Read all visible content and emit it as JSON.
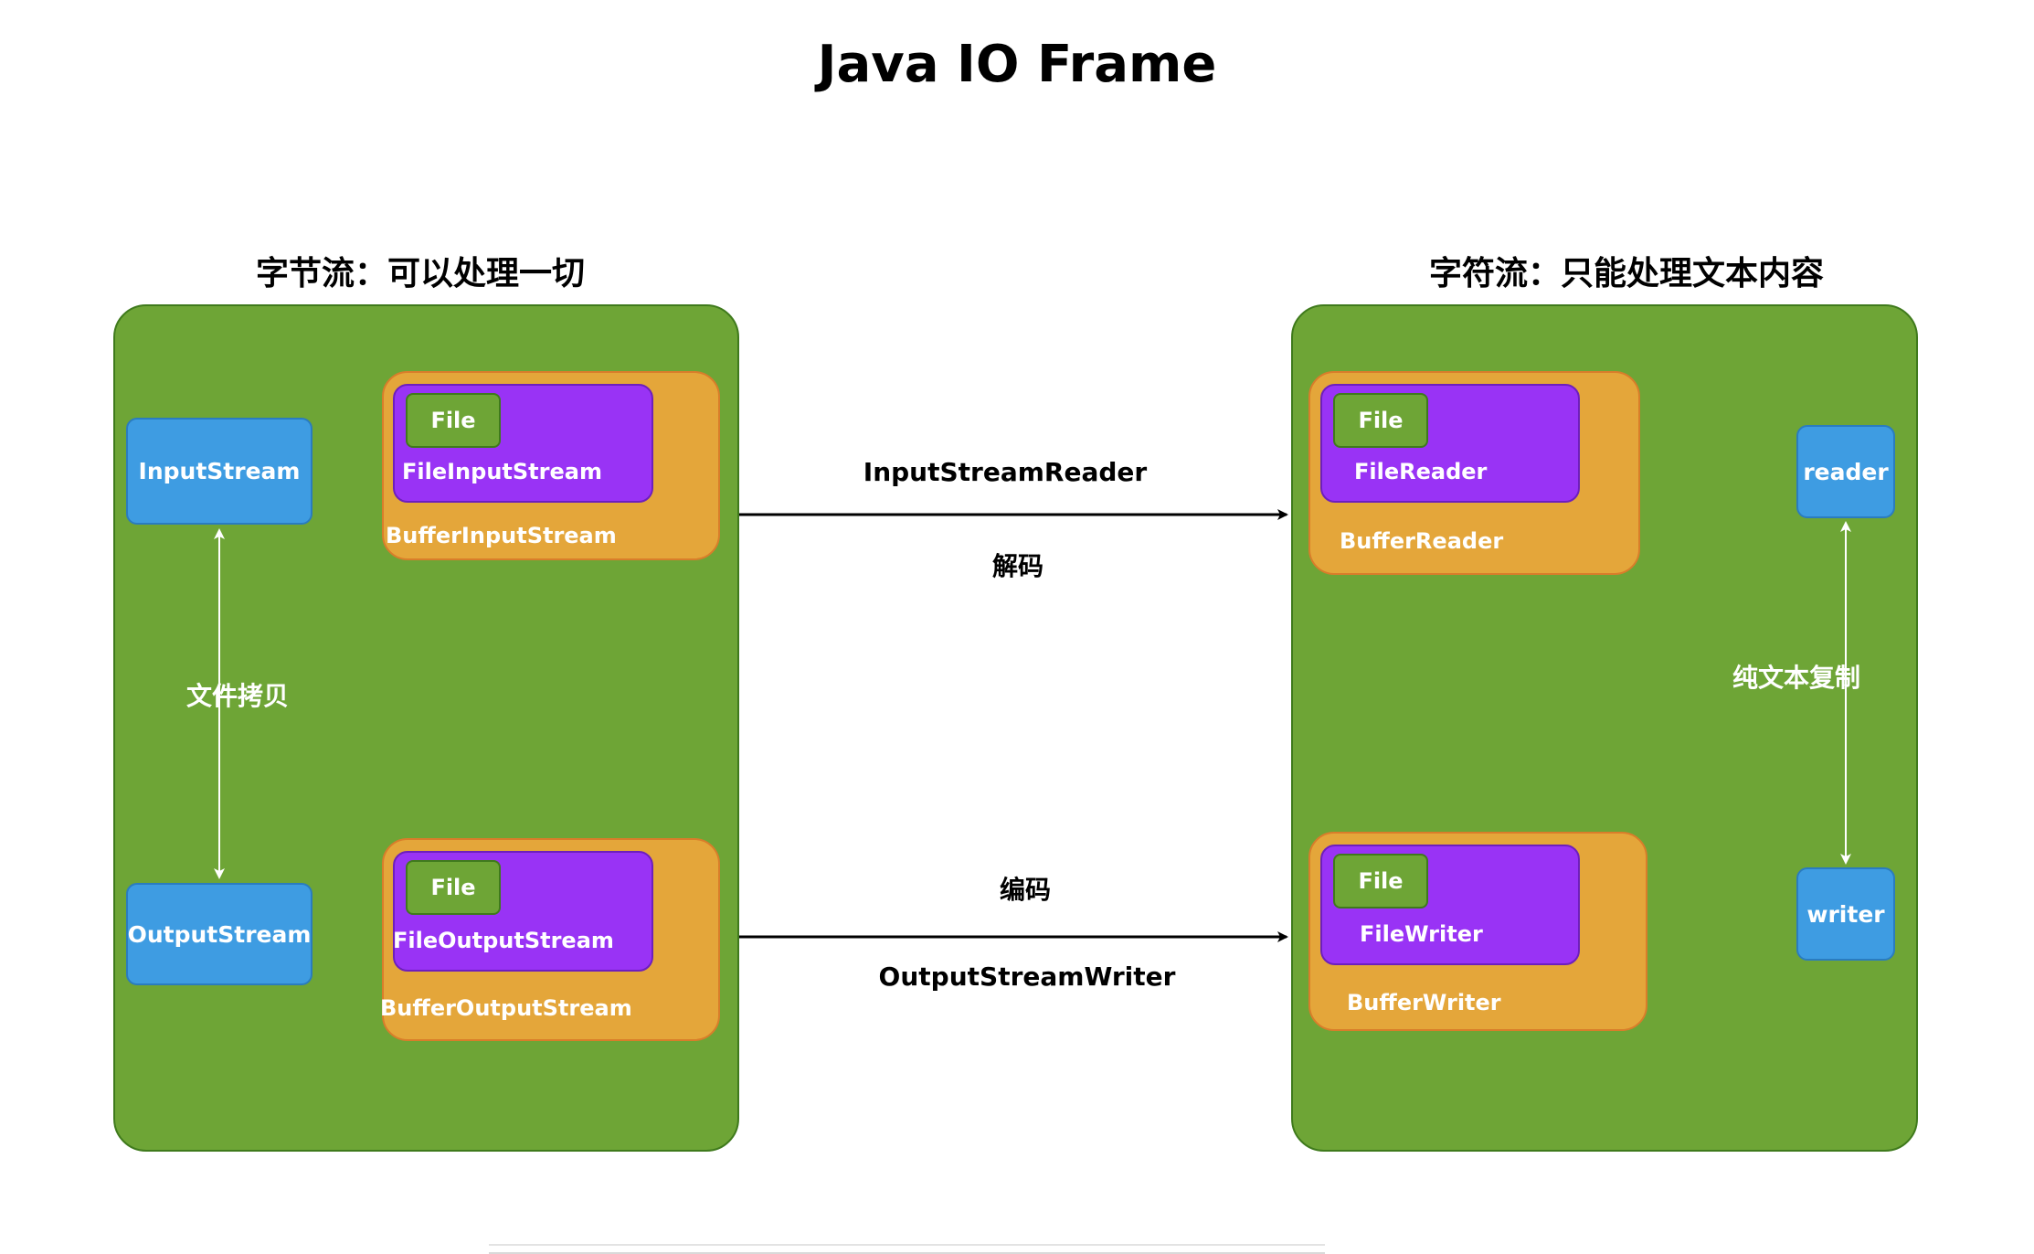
{
  "title": "Java IO Frame",
  "byte_stream": {
    "heading": "字节流：可以处理一切",
    "input_stream": "InputStream",
    "output_stream": "OutputStream",
    "copy_label": "文件拷贝",
    "buffer_input": {
      "outer": "BufferInputStream",
      "inner": "FileInputStream",
      "file": "File"
    },
    "buffer_output": {
      "outer": "BufferOutputStream",
      "inner": "FileOutputStream",
      "file": "File"
    }
  },
  "char_stream": {
    "heading": "字符流：只能处理文本内容",
    "reader": "reader",
    "writer": "writer",
    "copy_label": "纯文本复制",
    "buffer_reader": {
      "outer": "BufferReader",
      "inner": "FileReader",
      "file": "File"
    },
    "buffer_writer": {
      "outer": "BufferWriter",
      "inner": "FileWriter",
      "file": "File"
    }
  },
  "connectors": {
    "top_name": "InputStreamReader",
    "top_action": "解码",
    "bottom_action": "编码",
    "bottom_name": "OutputStreamWriter"
  },
  "colors": {
    "panel_green": "#6ea536",
    "buffer_orange": "#e4a63a",
    "stream_purple": "#9933f5",
    "base_blue": "#3e9ce2"
  }
}
